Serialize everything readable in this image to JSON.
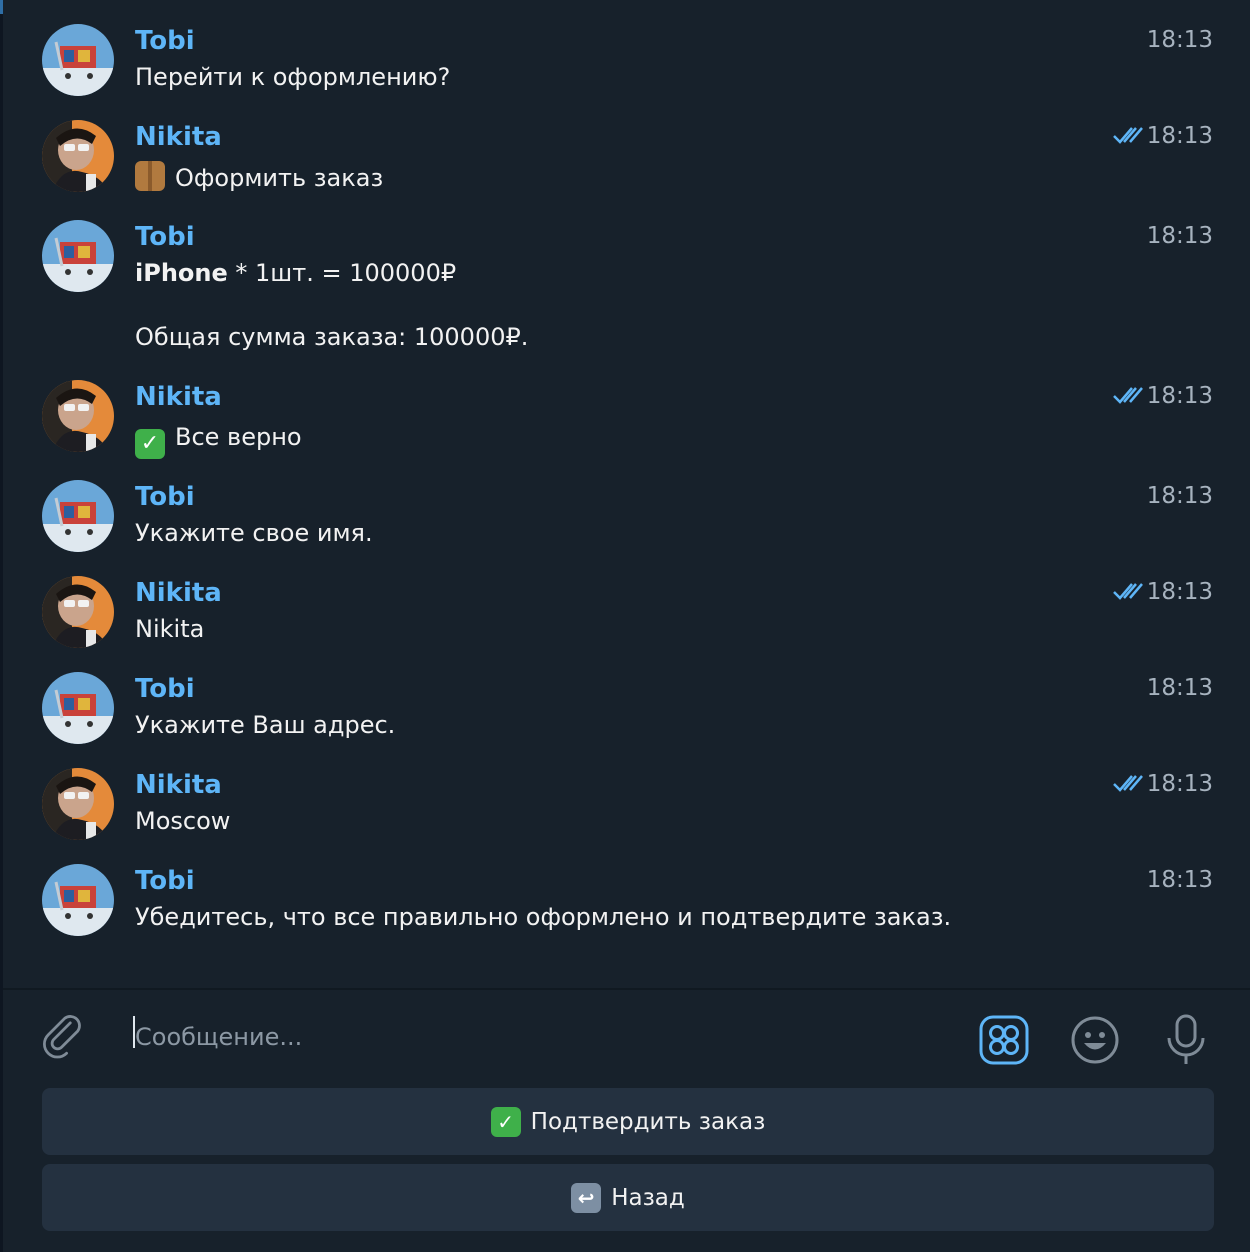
{
  "colors": {
    "background": "#17212b",
    "accent": "#5eb5f7",
    "button": "#243140",
    "time": "#a7b3bf"
  },
  "messages": [
    {
      "sender": "Tobi",
      "time": "18:13",
      "lines": [
        "Перейти к оформлению?"
      ]
    },
    {
      "sender": "Nikita",
      "time": "18:13",
      "read": true,
      "emoji": "package-emoji",
      "text": "Оформить заказ"
    },
    {
      "sender": "Tobi",
      "time": "18:13",
      "bold": "iPhone",
      "line1_rest": " * 1шт. = 100000₽",
      "line3": "Общая сумма заказа: 100000₽."
    },
    {
      "sender": "Nikita",
      "time": "18:13",
      "read": true,
      "emoji": "check-mark-emoji",
      "text": "Все верно"
    },
    {
      "sender": "Tobi",
      "time": "18:13",
      "lines": [
        "Укажите свое имя."
      ]
    },
    {
      "sender": "Nikita",
      "time": "18:13",
      "read": true,
      "lines": [
        "Nikita"
      ]
    },
    {
      "sender": "Tobi",
      "time": "18:13",
      "lines": [
        "Укажите Ваш адрес."
      ]
    },
    {
      "sender": "Nikita",
      "time": "18:13",
      "read": true,
      "lines": [
        "Moscow"
      ]
    },
    {
      "sender": "Tobi",
      "time": "18:13",
      "lines": [
        "Убедитесь, что все правильно оформлено и подтвердите заказ."
      ]
    }
  ],
  "composer": {
    "placeholder": "Сообщение...",
    "icons": [
      "paperclip-icon",
      "bot-commands-icon",
      "emoji-icon",
      "microphone-icon"
    ]
  },
  "keyboard": {
    "confirm_label": "Подтвердить заказ",
    "confirm_emoji": "check-mark-emoji",
    "back_label": "Назад",
    "back_emoji": "return-arrow-emoji"
  }
}
